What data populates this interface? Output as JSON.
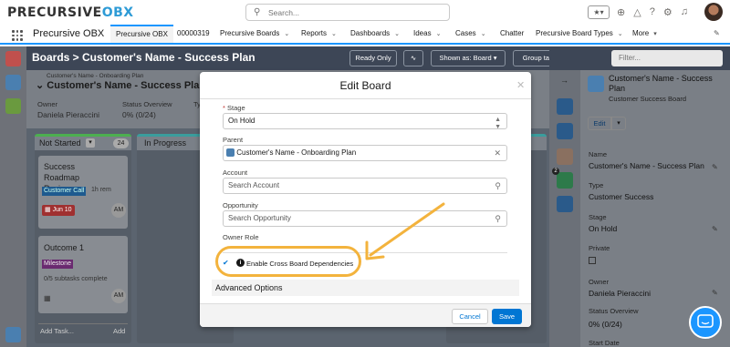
{
  "app": {
    "logo_text_a": "PRECURSIVE",
    "logo_text_b": "OBX",
    "search_placeholder": "Search...",
    "app_name": "Precursive OBX"
  },
  "nav": {
    "items": [
      {
        "label": "Precursive OBX",
        "active": true
      },
      {
        "label": "00000319"
      },
      {
        "label": "Precursive Boards"
      },
      {
        "label": "Reports"
      },
      {
        "label": "Dashboards"
      },
      {
        "label": "Ideas"
      },
      {
        "label": "Cases"
      },
      {
        "label": "Chatter"
      },
      {
        "label": "Precursive Board Types"
      },
      {
        "label": "More"
      }
    ]
  },
  "board_header": {
    "title": "Boards > Customer's Name - Success Plan",
    "ready_only": "Ready Only",
    "shown_as": "Shown as: Board",
    "group_tasks": "Group tasks by: None",
    "filter_placeholder": "Filter..."
  },
  "summary": {
    "breadcrumb": "Customer's Name - Onboarding Plan",
    "title": "Customer's Name - Success Plan",
    "owner_label": "Owner",
    "owner_value": "Daniela Pieraccini",
    "status_label": "Status Overview",
    "status_value": "0% (0/24)",
    "type_label": "Ty"
  },
  "columns": [
    {
      "name": "Not Started",
      "count": "24"
    },
    {
      "name": "In Progress"
    }
  ],
  "cards": [
    {
      "title": "Success Roadmap Review",
      "tag": "Customer Call",
      "duration": "1h rem",
      "date": "Jun 10",
      "avatar": "AM"
    },
    {
      "title": "Outcome 1",
      "tag": "Milestone",
      "subtasks": "0/5 subtasks complete",
      "avatar": "AM"
    }
  ],
  "add_task": {
    "placeholder": "Add Task...",
    "button": "Add"
  },
  "right_panel": {
    "title": "Customer's Name - Success Plan",
    "subtitle": "Customer Success Board",
    "edit": "Edit",
    "badge": "2",
    "fields": [
      {
        "label": "Name",
        "value": "Customer's Name - Success Plan"
      },
      {
        "label": "Type",
        "value": "Customer Success"
      },
      {
        "label": "Stage",
        "value": "On Hold"
      },
      {
        "label": "Private",
        "value": ""
      },
      {
        "label": "Owner",
        "value": "Daniela Pieraccini"
      },
      {
        "label": "Status Overview",
        "value": "0% (0/24)"
      },
      {
        "label": "Start Date",
        "value": ""
      }
    ]
  },
  "modal": {
    "title": "Edit Board",
    "stage_label": "Stage",
    "stage_required": "*",
    "stage_value": "On Hold",
    "parent_label": "Parent",
    "parent_value": "Customer's Name - Onboarding Plan",
    "account_label": "Account",
    "account_placeholder": "Search Account",
    "opportunity_label": "Opportunity",
    "opportunity_placeholder": "Search Opportunity",
    "owner_role_label": "Owner Role",
    "cbd_label": "Enable Cross Board Dependencies",
    "cbd_checked": true,
    "advanced_label": "Advanced Options",
    "cancel_label": "Cancel",
    "save_label": "Save"
  },
  "colors": {
    "brand_blue": "#0176d3",
    "highlight": "#f3b33d",
    "header_dark": "#3d4656"
  }
}
